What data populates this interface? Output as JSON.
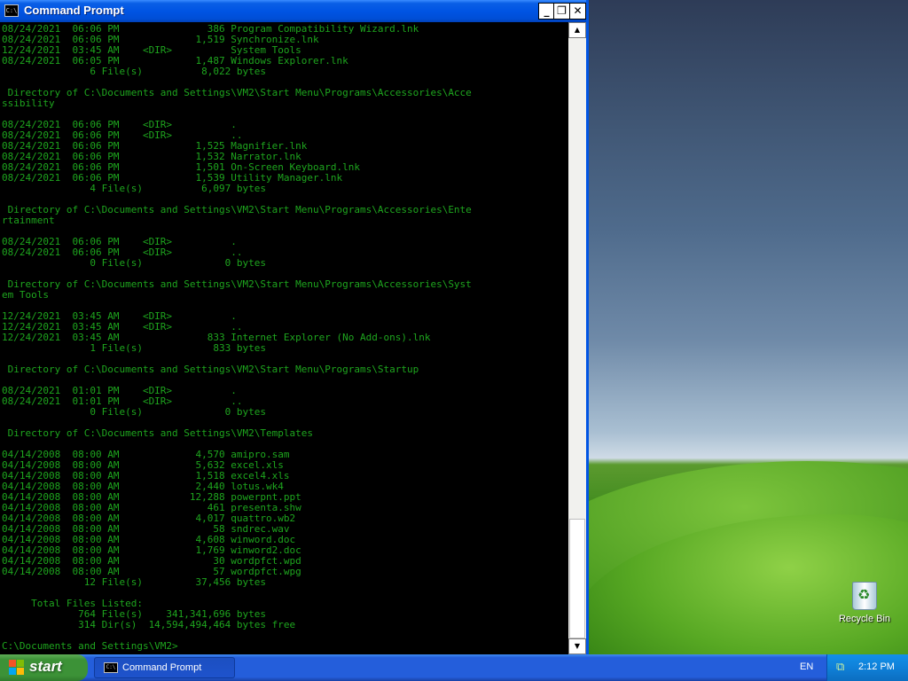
{
  "desktop": {
    "recycle_bin_label": "Recycle Bin"
  },
  "window": {
    "title": "Command Prompt",
    "icon_text": "C:\\",
    "minimize_glyph": "_",
    "maximize_glyph": "❐",
    "close_glyph": "✕"
  },
  "scrollbar": {
    "up_glyph": "▲",
    "down_glyph": "▼"
  },
  "console": {
    "lines": [
      "08/24/2021  06:06 PM               386 Program Compatibility Wizard.lnk",
      "08/24/2021  06:06 PM             1,519 Synchronize.lnk",
      "12/24/2021  03:45 AM    <DIR>          System Tools",
      "08/24/2021  06:05 PM             1,487 Windows Explorer.lnk",
      "               6 File(s)          8,022 bytes",
      "",
      " Directory of C:\\Documents and Settings\\VM2\\Start Menu\\Programs\\Accessories\\Acce",
      "ssibility",
      "",
      "08/24/2021  06:06 PM    <DIR>          .",
      "08/24/2021  06:06 PM    <DIR>          ..",
      "08/24/2021  06:06 PM             1,525 Magnifier.lnk",
      "08/24/2021  06:06 PM             1,532 Narrator.lnk",
      "08/24/2021  06:06 PM             1,501 On-Screen Keyboard.lnk",
      "08/24/2021  06:06 PM             1,539 Utility Manager.lnk",
      "               4 File(s)          6,097 bytes",
      "",
      " Directory of C:\\Documents and Settings\\VM2\\Start Menu\\Programs\\Accessories\\Ente",
      "rtainment",
      "",
      "08/24/2021  06:06 PM    <DIR>          .",
      "08/24/2021  06:06 PM    <DIR>          ..",
      "               0 File(s)              0 bytes",
      "",
      " Directory of C:\\Documents and Settings\\VM2\\Start Menu\\Programs\\Accessories\\Syst",
      "em Tools",
      "",
      "12/24/2021  03:45 AM    <DIR>          .",
      "12/24/2021  03:45 AM    <DIR>          ..",
      "12/24/2021  03:45 AM               833 Internet Explorer (No Add-ons).lnk",
      "               1 File(s)            833 bytes",
      "",
      " Directory of C:\\Documents and Settings\\VM2\\Start Menu\\Programs\\Startup",
      "",
      "08/24/2021  01:01 PM    <DIR>          .",
      "08/24/2021  01:01 PM    <DIR>          ..",
      "               0 File(s)              0 bytes",
      "",
      " Directory of C:\\Documents and Settings\\VM2\\Templates",
      "",
      "04/14/2008  08:00 AM             4,570 amipro.sam",
      "04/14/2008  08:00 AM             5,632 excel.xls",
      "04/14/2008  08:00 AM             1,518 excel4.xls",
      "04/14/2008  08:00 AM             2,440 lotus.wk4",
      "04/14/2008  08:00 AM            12,288 powerpnt.ppt",
      "04/14/2008  08:00 AM               461 presenta.shw",
      "04/14/2008  08:00 AM             4,017 quattro.wb2",
      "04/14/2008  08:00 AM                58 sndrec.wav",
      "04/14/2008  08:00 AM             4,608 winword.doc",
      "04/14/2008  08:00 AM             1,769 winword2.doc",
      "04/14/2008  08:00 AM                30 wordpfct.wpd",
      "04/14/2008  08:00 AM                57 wordpfct.wpg",
      "              12 File(s)         37,456 bytes",
      "",
      "     Total Files Listed:",
      "             764 File(s)    341,341,696 bytes",
      "             314 Dir(s)  14,594,494,464 bytes free",
      "",
      "C:\\Documents and Settings\\VM2>"
    ]
  },
  "taskbar": {
    "start_label": "start",
    "task_button_label": "Command Prompt",
    "task_icon_text": "C:\\",
    "language": "EN",
    "clock": "2:12 PM",
    "tray_icon_glyph": "⧉"
  }
}
